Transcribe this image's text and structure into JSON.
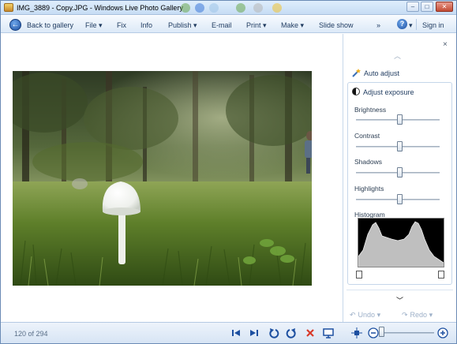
{
  "window": {
    "title": "IMG_3889 - Copy.JPG - Windows Live Photo Gallery"
  },
  "commandbar": {
    "back": "Back to gallery",
    "file": "File",
    "fix": "Fix",
    "info": "Info",
    "publish": "Publish",
    "email": "E-mail",
    "print": "Print",
    "make": "Make",
    "slideshow": "Slide show",
    "more": "»",
    "signin": "Sign in"
  },
  "panel": {
    "close": "×",
    "auto_adjust": "Auto adjust",
    "adjust_exposure": "Adjust exposure",
    "controls": [
      {
        "label": "Brightness",
        "level": 0.5
      },
      {
        "label": "Contrast",
        "level": 0.5
      },
      {
        "label": "Shadows",
        "level": 0.5
      },
      {
        "label": "Highlights",
        "level": 0.5
      }
    ],
    "histogram_label": "Histogram",
    "undo": "Undo",
    "redo": "Redo"
  },
  "status": {
    "position": "120 of 294",
    "zoom_level": 0.04
  },
  "icons": {
    "back": "back-arrow-icon",
    "help": "help-icon",
    "wand": "auto-adjust-wand-icon",
    "exposure": "exposure-icon",
    "first": "previous-icon",
    "next": "next-icon",
    "rotate_left": "rotate-counterclockwise-icon",
    "rotate_right": "rotate-clockwise-icon",
    "delete": "delete-icon",
    "slideshow": "slideshow-icon",
    "fit": "actual-size-icon",
    "zoom_out": "zoom-out-icon",
    "zoom_in": "zoom-in-icon"
  },
  "colors": {
    "accent": "#1c4fa0",
    "delete": "#d83a2a"
  }
}
